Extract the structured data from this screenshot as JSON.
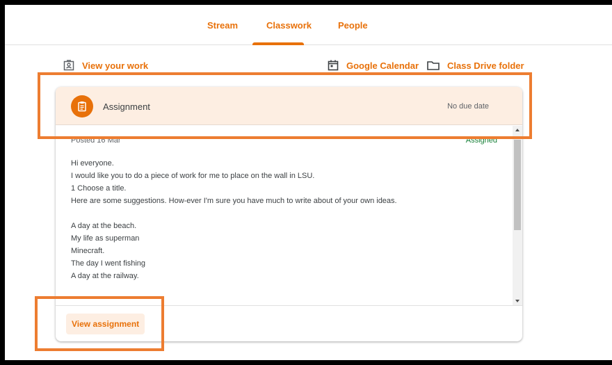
{
  "tabs": [
    {
      "label": "Stream"
    },
    {
      "label": "Classwork",
      "active": true
    },
    {
      "label": "People"
    }
  ],
  "toolbar": {
    "view_work": "View your work",
    "calendar": "Google Calendar",
    "drive": "Class Drive folder"
  },
  "assignment": {
    "title": "Assignment",
    "due": "No due date",
    "posted": "Posted 16 Mar",
    "status": "Assigned",
    "body": [
      "Hi everyone.",
      "I would like you to do a piece of work for me to place on the wall in LSU.",
      "1 Choose a title.",
      "Here are some suggestions. How-ever I'm sure you have much to write about of your own ideas.",
      "",
      "A day at the beach.",
      "My life as superman",
      "Minecraft.",
      "The day I went fishing",
      "A day at the railway."
    ],
    "view_button": "View assignment"
  },
  "colors": {
    "accent": "#e8710a",
    "highlight": "#ed7d31",
    "header_bg": "#fdeee2",
    "status_green": "#188038"
  },
  "icons": [
    "view-work-icon",
    "calendar-icon",
    "folder-icon",
    "assignment-icon"
  ]
}
